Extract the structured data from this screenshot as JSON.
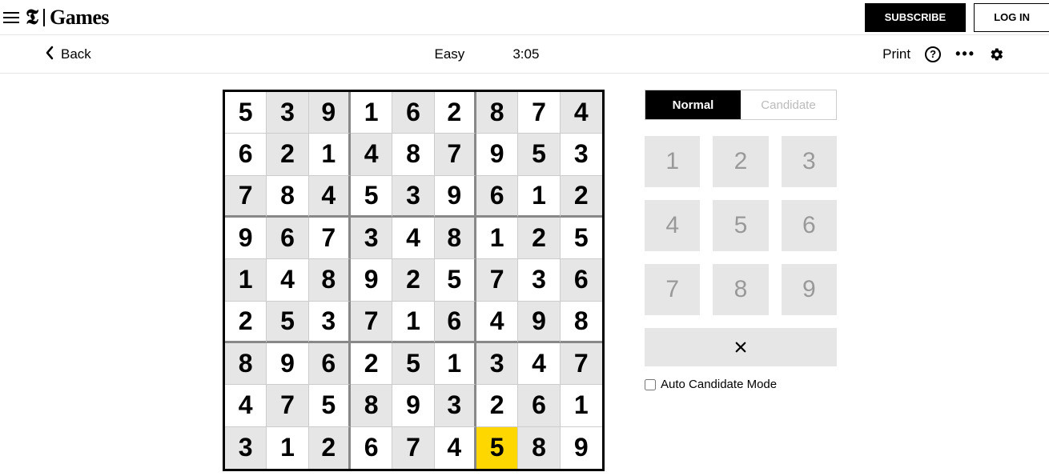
{
  "header": {
    "brand_t": "𝕿",
    "brand_games": "Games",
    "subscribe": "SUBSCRIBE",
    "login": "LOG IN"
  },
  "toolbar": {
    "back": "Back",
    "difficulty": "Easy",
    "timer": "3:05",
    "print": "Print"
  },
  "modes": {
    "normal": "Normal",
    "candidate": "Candidate"
  },
  "keypad": [
    "1",
    "2",
    "3",
    "4",
    "5",
    "6",
    "7",
    "8",
    "9"
  ],
  "auto_candidate_label": "Auto Candidate Mode",
  "board": {
    "values": [
      [
        "5",
        "3",
        "9",
        "1",
        "6",
        "2",
        "8",
        "7",
        "4"
      ],
      [
        "6",
        "2",
        "1",
        "4",
        "8",
        "7",
        "9",
        "5",
        "3"
      ],
      [
        "7",
        "8",
        "4",
        "5",
        "3",
        "9",
        "6",
        "1",
        "2"
      ],
      [
        "9",
        "6",
        "7",
        "3",
        "4",
        "8",
        "1",
        "2",
        "5"
      ],
      [
        "1",
        "4",
        "8",
        "9",
        "2",
        "5",
        "7",
        "3",
        "6"
      ],
      [
        "2",
        "5",
        "3",
        "7",
        "1",
        "6",
        "4",
        "9",
        "8"
      ],
      [
        "8",
        "9",
        "6",
        "2",
        "5",
        "1",
        "3",
        "4",
        "7"
      ],
      [
        "4",
        "7",
        "5",
        "8",
        "9",
        "3",
        "2",
        "6",
        "1"
      ],
      [
        "3",
        "1",
        "2",
        "6",
        "7",
        "4",
        "5",
        "8",
        "9"
      ]
    ],
    "given": [
      [
        false,
        true,
        true,
        false,
        true,
        false,
        true,
        false,
        true
      ],
      [
        false,
        true,
        false,
        true,
        false,
        true,
        false,
        true,
        false
      ],
      [
        true,
        false,
        true,
        false,
        true,
        false,
        true,
        false,
        true
      ],
      [
        false,
        true,
        false,
        true,
        false,
        true,
        false,
        true,
        false
      ],
      [
        true,
        false,
        true,
        false,
        true,
        false,
        true,
        false,
        true
      ],
      [
        false,
        true,
        false,
        true,
        false,
        true,
        false,
        true,
        false
      ],
      [
        true,
        false,
        true,
        false,
        true,
        false,
        true,
        false,
        true
      ],
      [
        false,
        true,
        false,
        true,
        false,
        true,
        false,
        true,
        false
      ],
      [
        true,
        false,
        true,
        false,
        true,
        false,
        false,
        true,
        false
      ]
    ],
    "selected": [
      8,
      6
    ]
  }
}
